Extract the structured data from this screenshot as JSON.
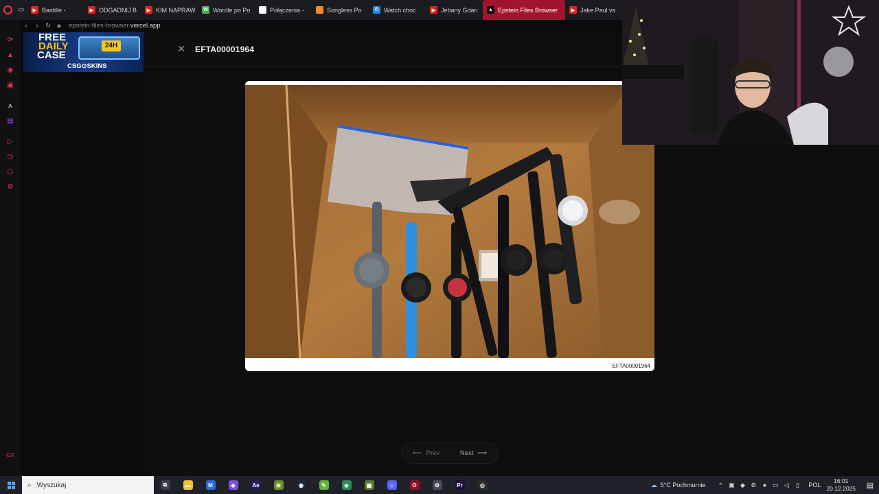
{
  "tabs": [
    {
      "label": "Bastille -",
      "color": "#e62117",
      "glyph": "▶"
    },
    {
      "label": "ODGADNIJ B",
      "color": "#e62117",
      "glyph": "▶"
    },
    {
      "label": "KIM NAPRAW",
      "color": "#e62117",
      "glyph": "▶"
    },
    {
      "label": "Wordle po Po",
      "color": "#4caf50",
      "glyph": "W"
    },
    {
      "label": "Połączenia -",
      "color": "#ffffff",
      "glyph": ""
    },
    {
      "label": "Songless Po",
      "color": "#f28c28",
      "glyph": ""
    },
    {
      "label": "Watch choc",
      "color": "#1e88e5",
      "glyph": "⏻"
    },
    {
      "label": "Jebany Gdan",
      "color": "#e62117",
      "glyph": "▶"
    },
    {
      "label": "Epstein Files Browser",
      "color": "#111111",
      "glyph": "▲"
    },
    {
      "label": "Jake Paul vs",
      "color": "#e62117",
      "glyph": "▶"
    }
  ],
  "address": {
    "url_prefix": "epstein-files-browser.",
    "url_domain": "vercel.app"
  },
  "ad": {
    "line1": "FREE",
    "line2": "DAILY",
    "line3": "CASE",
    "badge": "24H",
    "brand": "CSG⊙SKINS"
  },
  "viewer": {
    "title": "EFTA00001964",
    "caption": "EFTA00001964",
    "close_glyph": "✕"
  },
  "pager": {
    "prev_label": "Prev",
    "next_label": "Next",
    "prev_arrow": "⟵",
    "next_arrow": "⟶"
  },
  "taskbar": {
    "search_placeholder": "Wyszukaj",
    "weather": "5°C  Pochmurnie",
    "language": "POL",
    "time": "16:01",
    "date": "20.12.2025",
    "apps": [
      {
        "name": "task-view-icon",
        "color": "#3a3d46",
        "glyph": "⧉"
      },
      {
        "name": "file-explorer-icon",
        "color": "#f2c12e",
        "glyph": "▬"
      },
      {
        "name": "app-m-icon",
        "color": "#2d6bdc",
        "glyph": "M"
      },
      {
        "name": "crystal-icon",
        "color": "#7b4fe0",
        "glyph": "◆"
      },
      {
        "name": "after-effects-icon",
        "color": "#2a1d5c",
        "glyph": "Ae"
      },
      {
        "name": "app-green-icon",
        "color": "#6b8e23",
        "glyph": "⊞"
      },
      {
        "name": "steam-icon",
        "color": "#1b2838",
        "glyph": "◉"
      },
      {
        "name": "notepad-icon",
        "color": "#64b23a",
        "glyph": "✎"
      },
      {
        "name": "app-leaf-icon",
        "color": "#2e8b57",
        "glyph": "◈"
      },
      {
        "name": "minecraft-icon",
        "color": "#5a7a32",
        "glyph": "▦"
      },
      {
        "name": "discord-icon",
        "color": "#5865f2",
        "glyph": "☺"
      },
      {
        "name": "opera-icon",
        "color": "#8f0f24",
        "glyph": "O"
      },
      {
        "name": "app-settings-icon",
        "color": "#444c55",
        "glyph": "⚙"
      },
      {
        "name": "premiere-icon",
        "color": "#1f0f3f",
        "glyph": "Pr"
      },
      {
        "name": "obs-icon",
        "color": "#2b2b2b",
        "glyph": "◎"
      }
    ]
  }
}
